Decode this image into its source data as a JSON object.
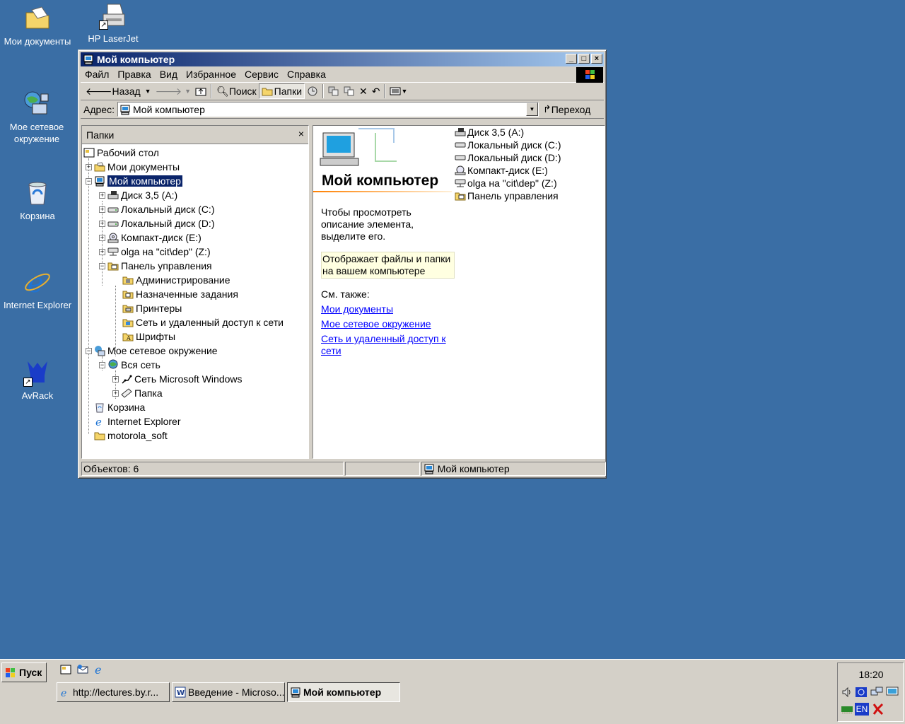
{
  "desktop": {
    "icons": [
      {
        "label": "Мои документы",
        "icon": "my-documents-icon"
      },
      {
        "label": "HP LaserJet",
        "icon": "printer-icon"
      },
      {
        "label": "Мое сетевое окружение",
        "icon": "network-places-icon"
      },
      {
        "label": "Корзина",
        "icon": "recycle-bin-icon"
      },
      {
        "label": "Internet Explorer",
        "icon": "internet-explorer-icon"
      },
      {
        "label": "AvRack",
        "icon": "avrack-icon"
      }
    ]
  },
  "window": {
    "title": "Мой компьютер",
    "menu": [
      "Файл",
      "Правка",
      "Вид",
      "Избранное",
      "Сервис",
      "Справка"
    ],
    "toolbar": {
      "back": "Назад",
      "search": "Поиск",
      "folders": "Папки"
    },
    "address": {
      "label": "Адрес:",
      "value": "Мой компьютер",
      "go": "Переход"
    },
    "folders_panel": {
      "title": "Папки",
      "close": "×",
      "tree": [
        {
          "label": "Рабочий стол"
        },
        {
          "label": "Мои документы"
        },
        {
          "label": "Мой компьютер"
        },
        {
          "label": "Диск 3,5 (A:)"
        },
        {
          "label": "Локальный диск (C:)"
        },
        {
          "label": "Локальный диск (D:)"
        },
        {
          "label": "Компакт-диск (E:)"
        },
        {
          "label": "olga на \"cit\\dep\" (Z:)"
        },
        {
          "label": "Панель управления"
        },
        {
          "label": "Администрирование"
        },
        {
          "label": "Назначенные задания"
        },
        {
          "label": "Принтеры"
        },
        {
          "label": "Сеть и удаленный доступ к сети"
        },
        {
          "label": "Шрифты"
        },
        {
          "label": "Мое сетевое окружение"
        },
        {
          "label": "Вся сеть"
        },
        {
          "label": "Сеть Microsoft Windows"
        },
        {
          "label": "Папка"
        },
        {
          "label": "Корзина"
        },
        {
          "label": "Internet Explorer"
        },
        {
          "label": "motorola_soft"
        }
      ]
    },
    "content": {
      "title": "Мой компьютер",
      "hint_lines": [
        "Чтобы просмотреть",
        "описание элемента,",
        "выделите его."
      ],
      "tip_lines": [
        "Отображает файлы и папки",
        "на вашем компьютере"
      ],
      "see_also": "См. также:",
      "links": [
        "Мои документы",
        "Мое сетевое окружение",
        "Сеть и удаленный доступ к",
        "сети"
      ],
      "items": [
        {
          "label": "Диск 3,5 (A:)",
          "icon": "floppy-drive-icon"
        },
        {
          "label": "Локальный диск (C:)",
          "icon": "hard-drive-icon"
        },
        {
          "label": "Локальный диск (D:)",
          "icon": "hard-drive-icon"
        },
        {
          "label": "Компакт-диск (E:)",
          "icon": "cd-drive-icon"
        },
        {
          "label": "olga на \"cit\\dep\" (Z:)",
          "icon": "network-drive-icon"
        },
        {
          "label": "Панель управления",
          "icon": "control-panel-icon"
        }
      ]
    },
    "status": {
      "objects": "Объектов: 6",
      "location": "Мой компьютер"
    }
  },
  "taskbar": {
    "start": "Пуск",
    "tasks": [
      {
        "label": "http://lectures.by.r..."
      },
      {
        "label": "Введение - Microso..."
      },
      {
        "label": "Мой компьютер"
      }
    ],
    "clock": "18:20",
    "lang": "EN"
  },
  "colors": {
    "desktop": "#3a6ea5",
    "title_active": "#0a246a",
    "face": "#d4d0c8",
    "link": "#0000ff",
    "tip": "#ffffe1"
  }
}
